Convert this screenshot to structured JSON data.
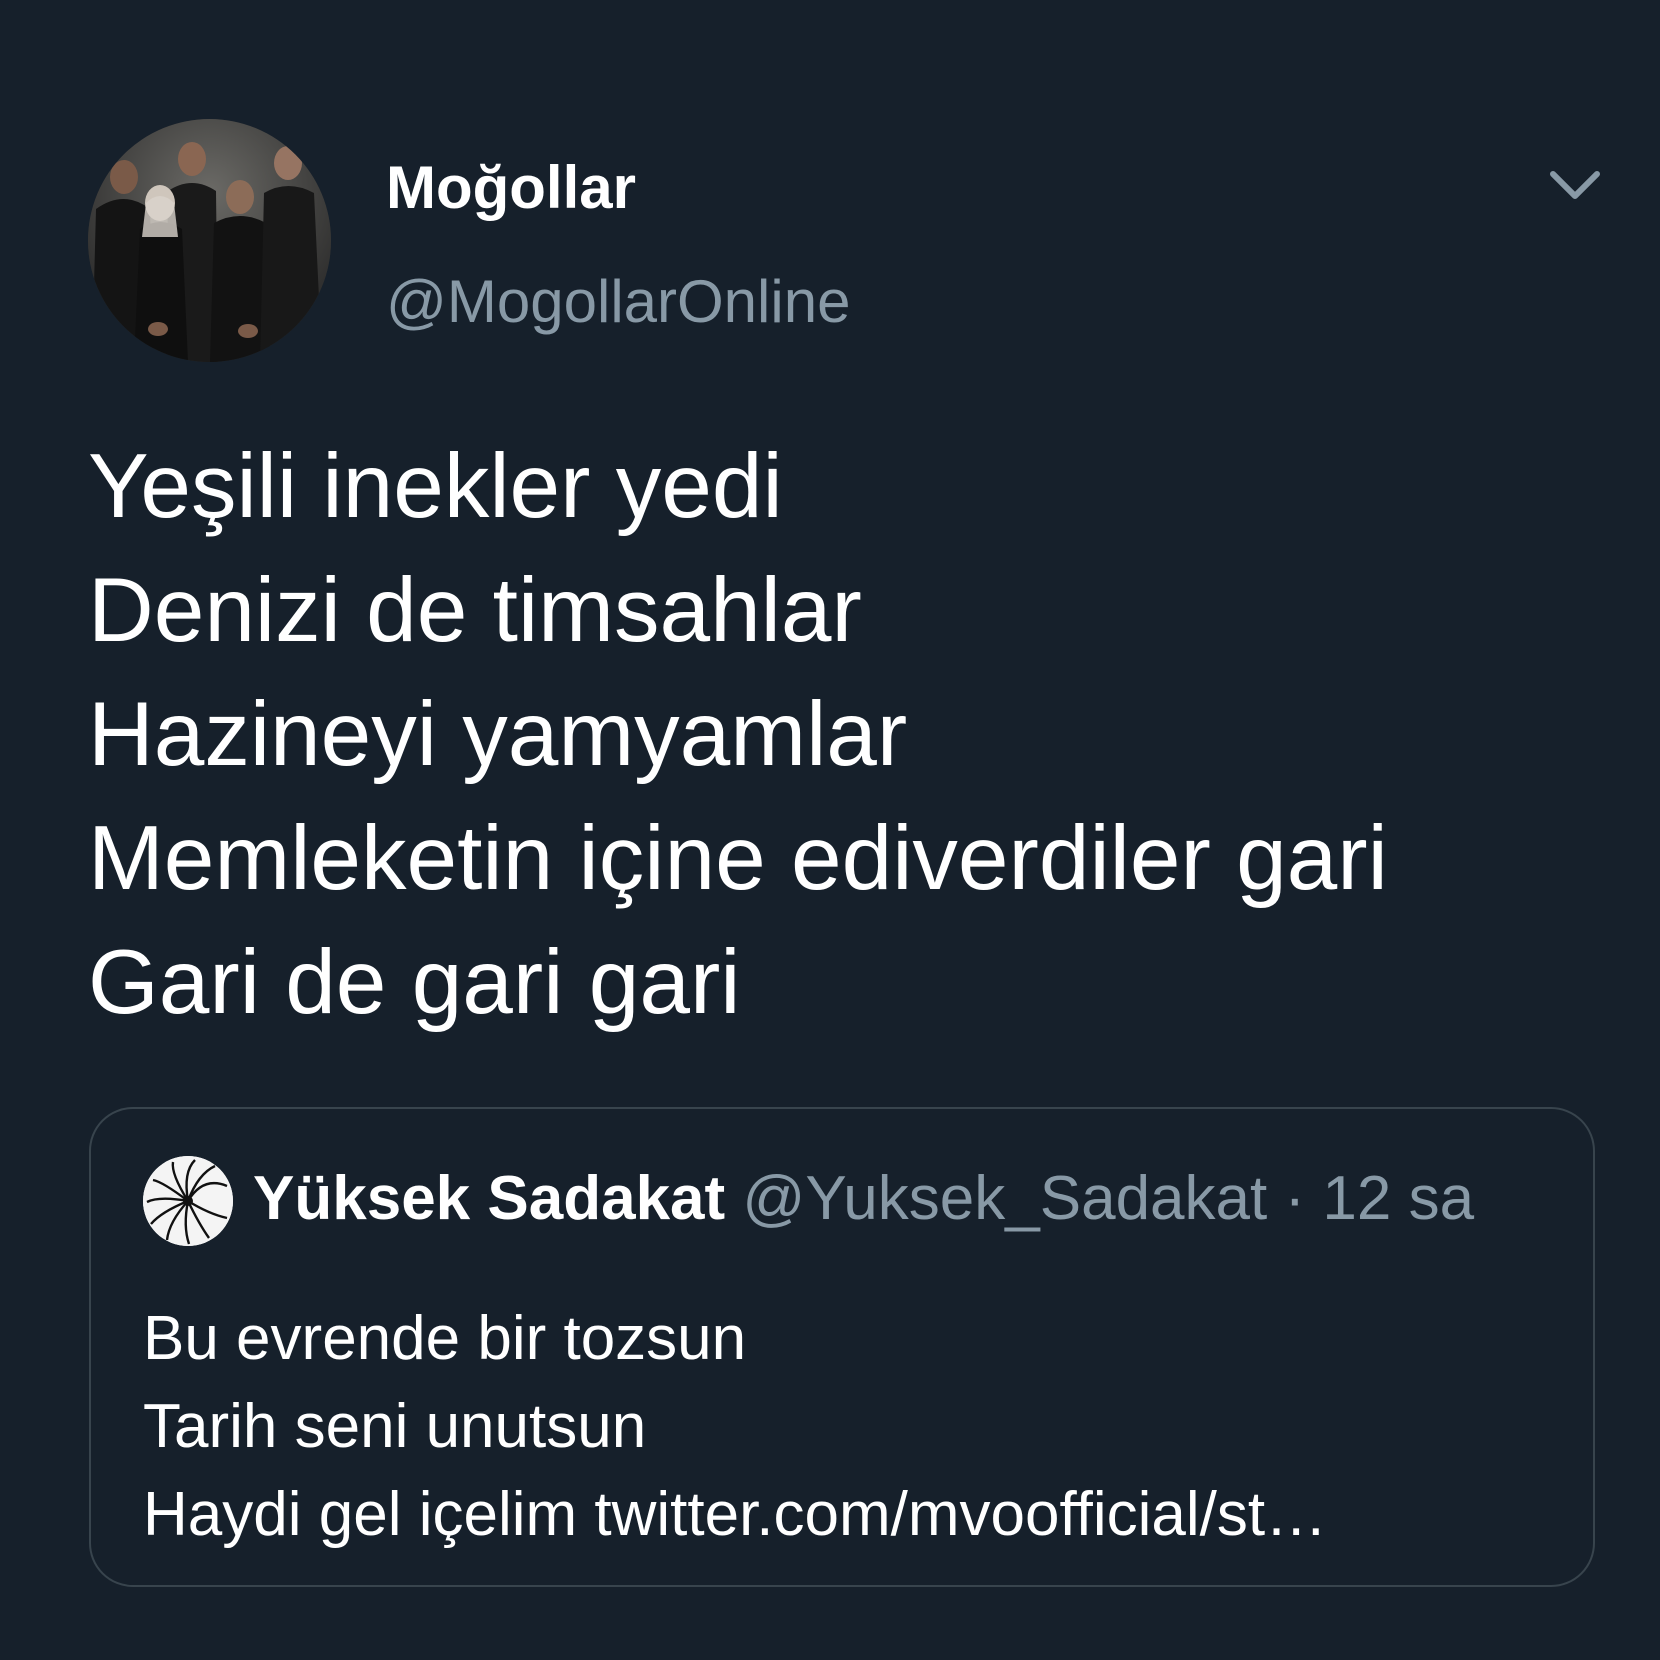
{
  "tweet": {
    "author_name": "Moğollar",
    "author_handle": "@MogollarOnline",
    "lines": [
      "Yeşili inekler yedi",
      "Denizi de timsahlar",
      "Hazineyi yamyamlar",
      "Memleketin içine ediverdiler gari",
      "Gari de gari gari"
    ]
  },
  "quoted": {
    "author_name": "Yüksek Sadakat",
    "author_handle": "@Yuksek_Sadakat",
    "separator": "·",
    "time": "12 sa",
    "lines": [
      "Bu evrende bir tozsun",
      "Tarih seni unutsun",
      "Haydi gel içelim twitter.com/mvoofficial/st…"
    ]
  },
  "icons": {
    "more": "chevron-down-icon"
  },
  "colors": {
    "background": "#16202b",
    "primary_text": "#ffffff",
    "secondary_text": "#8899a6",
    "border": "#38444d"
  }
}
